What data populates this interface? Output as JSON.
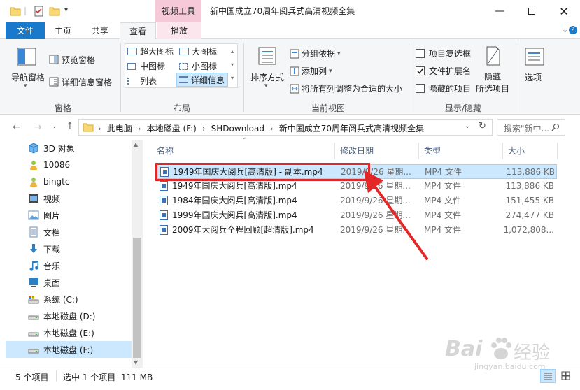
{
  "window": {
    "contextual_tab_group": "视频工具",
    "title": "新中国成立70周年阅兵式高清视频全集"
  },
  "tabs": {
    "file": "文件",
    "home": "主页",
    "share": "共享",
    "view": "查看",
    "play": "播放"
  },
  "ribbon": {
    "panes": {
      "nav_pane": "导航窗格",
      "preview_pane": "预览窗格",
      "details_pane": "详细信息窗格",
      "group_label": "窗格"
    },
    "layout": {
      "extra_large_icons": "超大图标",
      "large_icons": "大图标",
      "medium_icons": "中图标",
      "small_icons": "小图标",
      "list": "列表",
      "details": "详细信息",
      "group_label": "布局"
    },
    "current_view": {
      "sort_by": "排序方式",
      "group_by": "分组依据",
      "add_columns": "添加列",
      "size_all_columns": "将所有列调整为合适的大小",
      "group_label": "当前视图"
    },
    "show_hide": {
      "item_checkboxes": "项目复选框",
      "file_extensions": "文件扩展名",
      "hidden_items": "隐藏的项目",
      "hide_selected_line1": "隐藏",
      "hide_selected_line2": "所选项目",
      "group_label": "显示/隐藏",
      "item_checkboxes_checked": false,
      "file_extensions_checked": true,
      "hidden_items_checked": false
    },
    "options": "选项"
  },
  "address": {
    "crumbs": [
      "此电脑",
      "本地磁盘 (F:)",
      "SHDownload",
      "新中国成立70周年阅兵式高清视频全集"
    ],
    "search_placeholder": "搜索\"新中..."
  },
  "nav_pane": {
    "items": [
      {
        "label": "3D 对象",
        "icon": "cube-3d-icon"
      },
      {
        "label": "10086",
        "icon": "user-folder-icon"
      },
      {
        "label": "bingtc",
        "icon": "user-folder-icon"
      },
      {
        "label": "视频",
        "icon": "video-folder-icon"
      },
      {
        "label": "图片",
        "icon": "pictures-folder-icon"
      },
      {
        "label": "文档",
        "icon": "documents-folder-icon"
      },
      {
        "label": "下载",
        "icon": "download-arrow-icon"
      },
      {
        "label": "音乐",
        "icon": "music-note-icon"
      },
      {
        "label": "桌面",
        "icon": "desktop-icon"
      },
      {
        "label": "系统 (C:)",
        "icon": "system-drive-icon"
      },
      {
        "label": "本地磁盘 (D:)",
        "icon": "drive-icon"
      },
      {
        "label": "本地磁盘 (E:)",
        "icon": "drive-icon"
      },
      {
        "label": "本地磁盘 (F:)",
        "icon": "drive-icon"
      }
    ]
  },
  "columns": {
    "name": "名称",
    "date": "修改日期",
    "type": "类型",
    "size": "大小"
  },
  "files": [
    {
      "name": "1949年国庆大阅兵[高清版] - 副本.mp4",
      "date": "2019/9/26 星期...",
      "type": "MP4 文件",
      "size": "113,886 KB"
    },
    {
      "name": "1949年国庆大阅兵[高清版].mp4",
      "date": "2019/9/26 星期...",
      "type": "MP4 文件",
      "size": "113,886 KB"
    },
    {
      "name": "1984年国庆大阅兵[高清版].mp4",
      "date": "2019/9/26 星期...",
      "type": "MP4 文件",
      "size": "151,455 KB"
    },
    {
      "name": "1999年国庆大阅兵[高清版].mp4",
      "date": "2019/9/26 星期...",
      "type": "MP4 文件",
      "size": "274,477 KB"
    },
    {
      "name": "2009年大阅兵全程回顾[超清版].mp4",
      "date": "2019/9/26 星期...",
      "type": "MP4 文件",
      "size": "1,072,808..."
    }
  ],
  "status": {
    "item_count": "5 个项目",
    "selection": "选中 1 个项目  111 MB"
  },
  "watermark": {
    "brand": "Bai",
    "brand_cn": "经验",
    "url": "jingyan.baidu.com"
  },
  "colors": {
    "accent": "#1979ca",
    "selection": "#cce8ff",
    "annotation": "#e32626"
  }
}
